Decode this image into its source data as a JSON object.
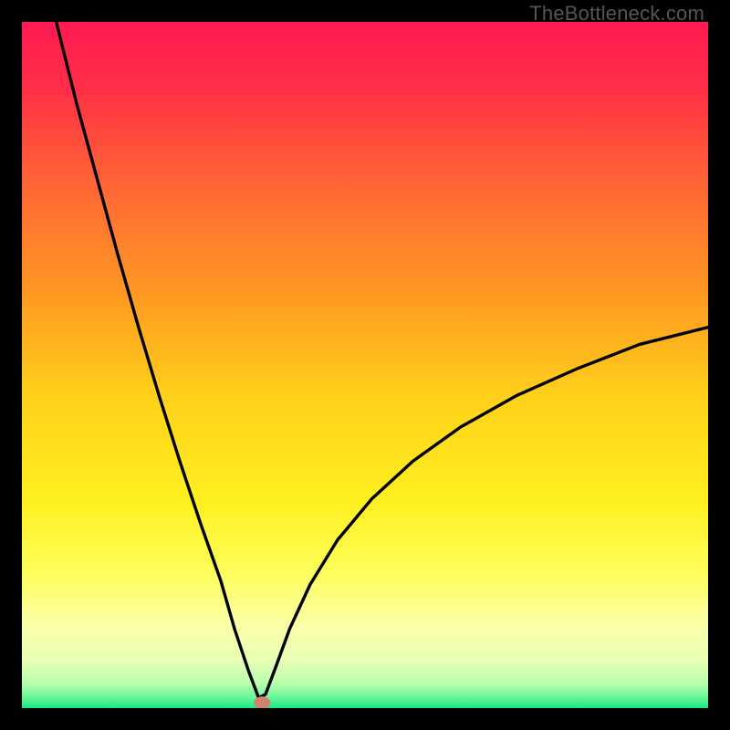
{
  "watermark": "TheBottleneck.com",
  "chart_data": {
    "type": "line",
    "title": "",
    "xlabel": "",
    "ylabel": "",
    "xlim": [
      0,
      100
    ],
    "ylim": [
      0,
      100
    ],
    "grid": false,
    "legend": false,
    "note": "V-shaped curve with minimum near x≈35, y≈0. Left branch rises steeply toward y≈100 at x≈5; right branch rises with decreasing slope toward y≈55 at x≈100. Background is a vertical gradient from red (top) through orange/yellow to green (bottom). A small salmon-colored marker sits at the minimum.",
    "gradient_stops": [
      {
        "offset": 0.0,
        "color": "#ff1a52"
      },
      {
        "offset": 0.1,
        "color": "#ff3046"
      },
      {
        "offset": 0.25,
        "color": "#ff6a33"
      },
      {
        "offset": 0.4,
        "color": "#ff9a22"
      },
      {
        "offset": 0.55,
        "color": "#ffd21a"
      },
      {
        "offset": 0.7,
        "color": "#fff020"
      },
      {
        "offset": 0.8,
        "color": "#fdfe5a"
      },
      {
        "offset": 0.88,
        "color": "#fbffa8"
      },
      {
        "offset": 0.93,
        "color": "#e8ffb4"
      },
      {
        "offset": 0.965,
        "color": "#b7ffae"
      },
      {
        "offset": 0.985,
        "color": "#66f59a"
      },
      {
        "offset": 1.0,
        "color": "#17e884"
      }
    ],
    "series": [
      {
        "name": "curve",
        "x": [
          5,
          8,
          11,
          14,
          17,
          20,
          23,
          26,
          29,
          31,
          33,
          34.5,
          35.5,
          37,
          39,
          42,
          46,
          51,
          57,
          64,
          72,
          81,
          90,
          100
        ],
        "y": [
          100,
          88,
          77,
          66,
          55.5,
          45.5,
          36,
          27,
          18.5,
          11.5,
          5.5,
          1.5,
          2,
          6,
          11.5,
          18,
          24.5,
          30.5,
          36,
          41,
          45.5,
          49.5,
          53,
          55.5
        ]
      }
    ],
    "marker": {
      "x": 35,
      "y": 0.8,
      "rx": 1.2,
      "ry": 0.9,
      "color": "#cf836f"
    }
  }
}
